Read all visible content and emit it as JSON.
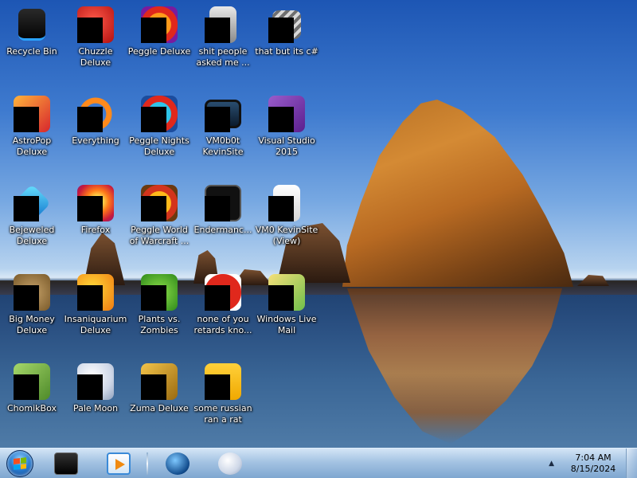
{
  "desktop": {
    "icons": [
      {
        "label": "Recycle Bin",
        "icon": "recycle-bin-icon"
      },
      {
        "label": "Chuzzle\nDeluxe",
        "icon": "chuzzle-icon"
      },
      {
        "label": "Peggle Deluxe",
        "icon": "peggle-icon"
      },
      {
        "label": "shit people\nasked me ...",
        "icon": "folder-icon"
      },
      {
        "label": "that but its c#",
        "icon": "stacked-files-icon"
      },
      {
        "label": "AstroPop\nDeluxe",
        "icon": "astropop-icon"
      },
      {
        "label": "Everything",
        "icon": "everything-search-icon"
      },
      {
        "label": "Peggle Nights\nDeluxe",
        "icon": "peggle-nights-icon"
      },
      {
        "label": "VM0b0t\nKevinSite",
        "icon": "monitor-icon"
      },
      {
        "label": "Visual Studio\n2015",
        "icon": "visual-studio-icon"
      },
      {
        "label": "Bejeweled\nDeluxe",
        "icon": "bejeweled-icon"
      },
      {
        "label": "Firefox",
        "icon": "firefox-icon"
      },
      {
        "label": "Peggle World\nof Warcraft ...",
        "icon": "peggle-wow-icon"
      },
      {
        "label": "Endermanc...",
        "icon": "terminal-icon"
      },
      {
        "label": "VM0 KevinSite\n(View)",
        "icon": "document-icon"
      },
      {
        "label": "Big Money\nDeluxe",
        "icon": "big-money-icon"
      },
      {
        "label": "Insaniquarium\nDeluxe",
        "icon": "insaniquarium-icon"
      },
      {
        "label": "Plants vs.\nZombies",
        "icon": "plants-vs-zombies-icon"
      },
      {
        "label": "none of you\nretards kno...",
        "icon": "peggle-red-icon"
      },
      {
        "label": "Windows Live\nMail",
        "icon": "windows-live-mail-icon"
      },
      {
        "label": "ChomikBox",
        "icon": "chomikbox-icon"
      },
      {
        "label": "Pale Moon",
        "icon": "pale-moon-icon"
      },
      {
        "label": "Zuma Deluxe",
        "icon": "zuma-icon"
      },
      {
        "label": "some russian\nran a rat",
        "icon": "russian-rat-icon"
      }
    ]
  },
  "taskbar": {
    "start": {
      "icon": "windows-start-orb-icon"
    },
    "pinned": [
      {
        "icon": "terminal-icon"
      },
      {
        "icon": "media-player-icon"
      },
      {
        "icon": "globe-icon"
      },
      {
        "icon": "pale-moon-icon"
      }
    ],
    "tray": {
      "chevron": "▲",
      "time": "7:04 AM",
      "date": "8/15/2024"
    }
  },
  "colors": {
    "taskbar_top": "#dcebfa",
    "taskbar_bottom": "#82aad2",
    "label_text": "#ffffff",
    "redaction": "#000000"
  }
}
